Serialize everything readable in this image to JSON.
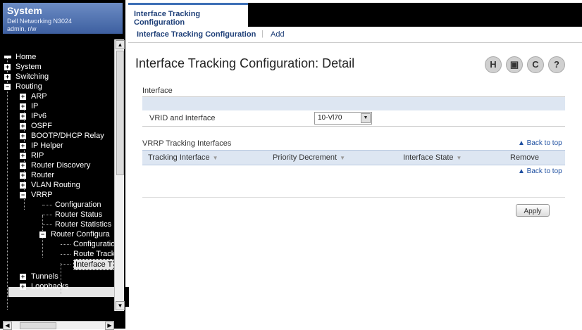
{
  "system": {
    "title": "System",
    "model": "Dell Networking N3024",
    "user": "admin, r/w"
  },
  "tree": [
    {
      "label": "Home",
      "icon": "home-icon"
    },
    {
      "label": "System"
    },
    {
      "label": "Switching"
    },
    {
      "label": "Routing"
    },
    {
      "label": "ARP"
    },
    {
      "label": "IP"
    },
    {
      "label": "IPv6"
    },
    {
      "label": "OSPF"
    },
    {
      "label": "BOOTP/DHCP Relay"
    },
    {
      "label": "IP Helper"
    },
    {
      "label": "RIP"
    },
    {
      "label": "Router Discovery"
    },
    {
      "label": "Router"
    },
    {
      "label": "VLAN Routing"
    },
    {
      "label": "VRRP"
    },
    {
      "label": "Configuration"
    },
    {
      "label": "Router Status"
    },
    {
      "label": "Router Statistics"
    },
    {
      "label": "Router Configura"
    },
    {
      "label": "Configuratio"
    },
    {
      "label": "Route Track"
    },
    {
      "label": "Interface T"
    },
    {
      "label": "Tunnels"
    },
    {
      "label": "Loopbacks"
    }
  ],
  "tabs": {
    "main": "Interface Tracking Configuration",
    "sub_config": "Interface Tracking Configuration",
    "sep": "|",
    "add": "Add"
  },
  "page": {
    "title": "Interface Tracking Configuration: Detail"
  },
  "toolbar": {
    "save": "H",
    "print": "▣",
    "refresh": "C",
    "help": "?"
  },
  "interface_section": {
    "title": "Interface",
    "vrid_label": "VRID and Interface",
    "vrid_value": "10-Vl70"
  },
  "vrrp_section": {
    "title": "VRRP Tracking Interfaces",
    "back_to_top": "▲ Back to top",
    "columns": [
      "Tracking Interface",
      "Priority Decrement",
      "Interface State",
      "Remove"
    ],
    "sort_glyph": "▼"
  },
  "apply_label": "Apply"
}
